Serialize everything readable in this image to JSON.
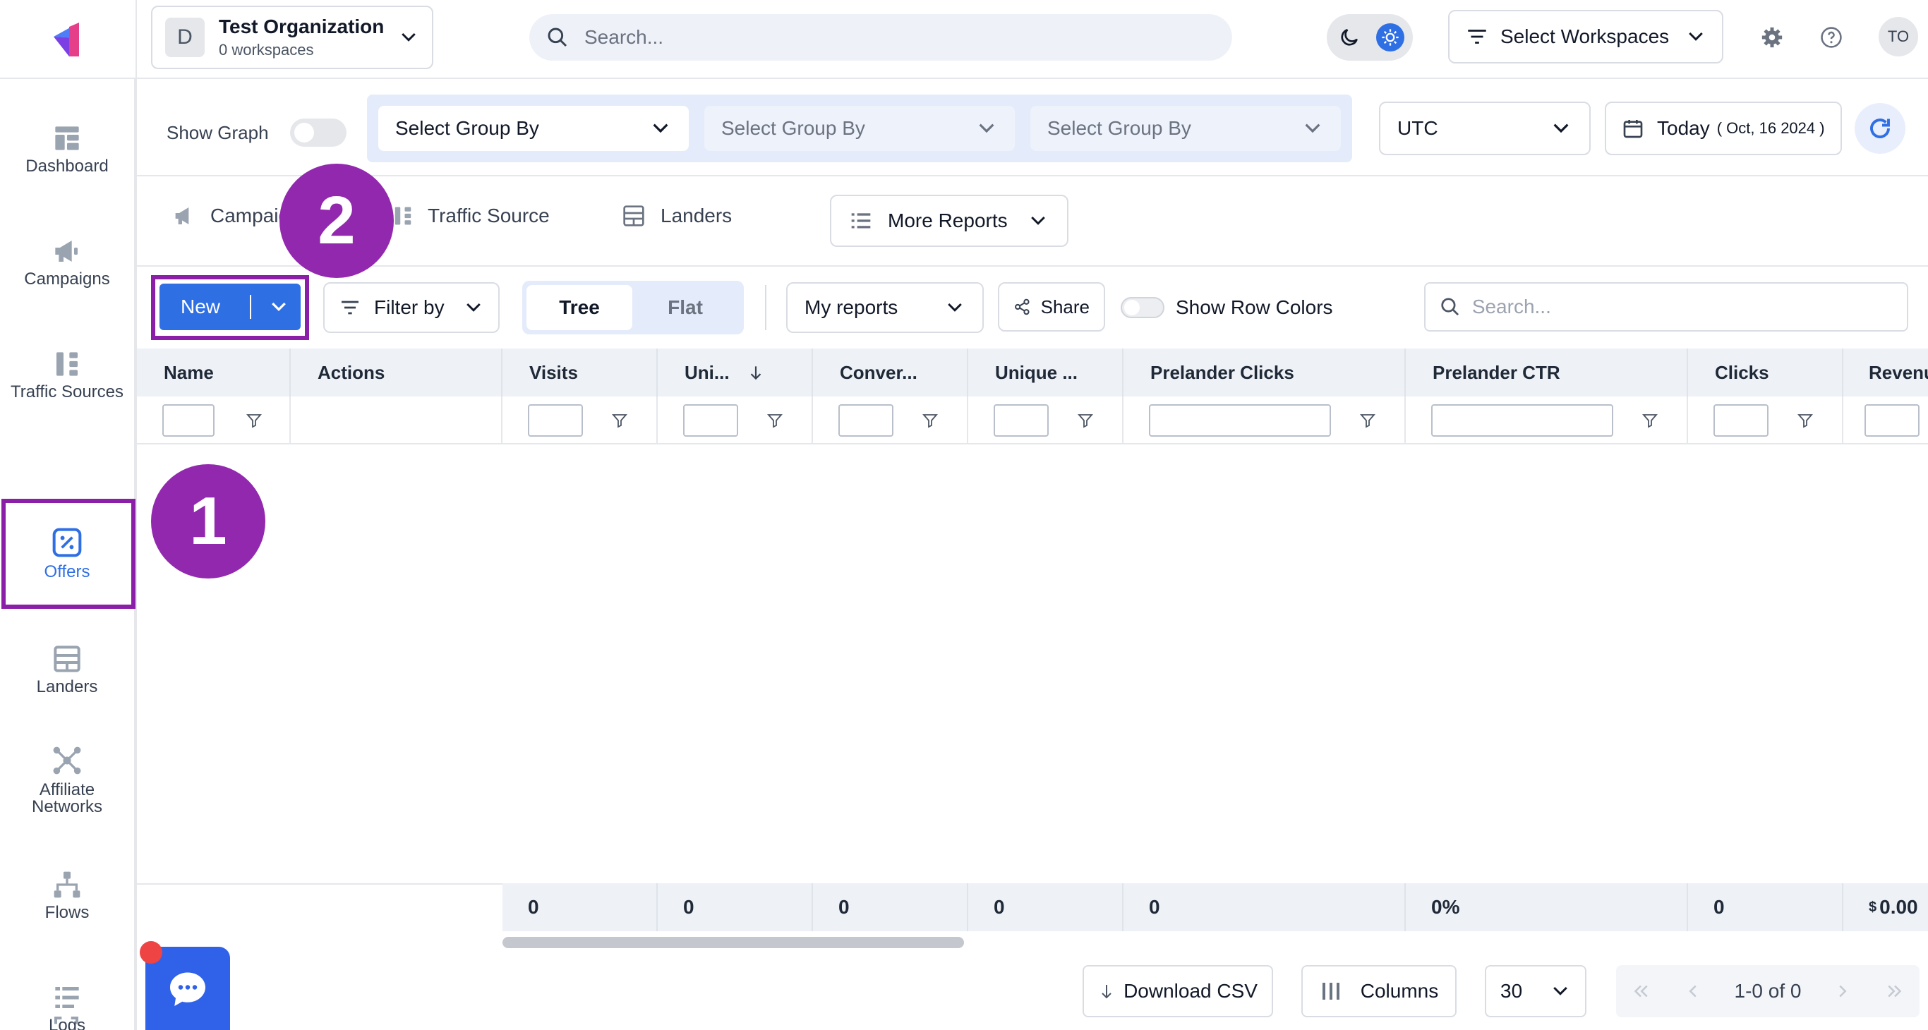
{
  "org": {
    "avatar": "D",
    "name": "Test Organization",
    "sub": "0 workspaces"
  },
  "search": {
    "placeholder": "Search..."
  },
  "workspaces": {
    "label": "Select Workspaces"
  },
  "user": {
    "initials": "TO"
  },
  "sidebar": {
    "items": [
      {
        "label": "Dashboard",
        "icon": "dashboard-icon"
      },
      {
        "label": "Campaigns",
        "icon": "megaphone-icon"
      },
      {
        "label": "Traffic Sources",
        "icon": "traffic-source-icon"
      },
      {
        "label": "Offers",
        "icon": "offers-icon",
        "active": true
      },
      {
        "label": "Landers",
        "icon": "lander-icon"
      },
      {
        "label": "Affiliate Networks",
        "icon": "network-icon"
      },
      {
        "label": "Flows",
        "icon": "flow-icon"
      },
      {
        "label": "Logs",
        "icon": "logs-icon"
      }
    ]
  },
  "filters": {
    "show_graph": "Show Graph",
    "group_by": [
      "Select Group By",
      "Select Group By",
      "Select Group By"
    ],
    "timezone": "UTC",
    "date_label": "Today",
    "date_range": "( Oct, 16 2024 )"
  },
  "report_tabs": {
    "campaigns": "Campaigns",
    "traffic_source": "Traffic Source",
    "landers": "Landers",
    "more": "More Reports"
  },
  "toolbar": {
    "new_label": "New",
    "filter_label": "Filter by",
    "tree": "Tree",
    "flat": "Flat",
    "my_reports": "My reports",
    "share": "Share",
    "row_colors": "Show Row Colors",
    "search_placeholder": "Search..."
  },
  "table": {
    "headers": [
      "Name",
      "Actions",
      "Visits",
      "Uni...",
      "Conver...",
      "Unique ...",
      "Prelander Clicks",
      "Prelander CTR",
      "Clicks",
      "Revenu"
    ],
    "totals": [
      "0",
      "0",
      "0",
      "0",
      "0",
      "0%",
      "0",
      "$0.00"
    ]
  },
  "footer": {
    "download": "Download CSV",
    "columns": "Columns",
    "page_size": "30",
    "range": "1-0 of 0"
  },
  "steps": {
    "one": "1",
    "two": "2"
  },
  "colors": {
    "accent": "#2f6fe4",
    "highlight": "#8b1fa8",
    "badge": "#9228ae"
  }
}
